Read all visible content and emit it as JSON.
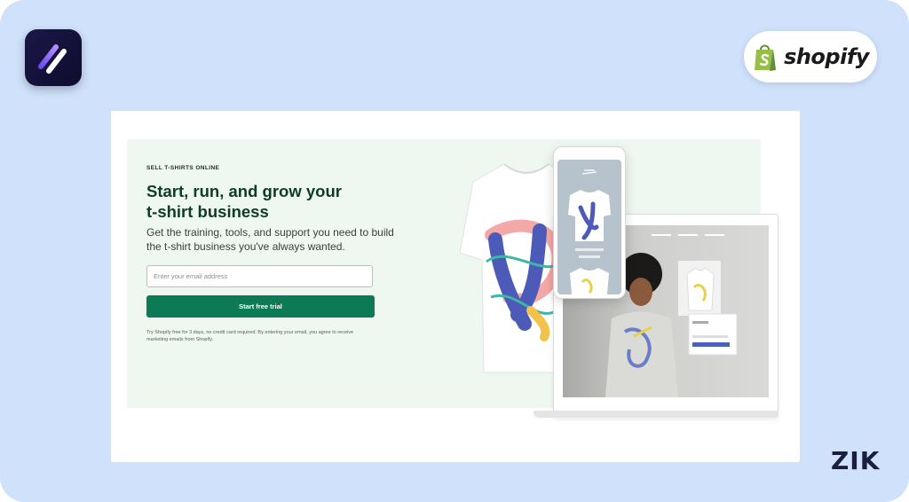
{
  "branding": {
    "app_logo_icon": "stripes-logo-icon",
    "shopify_wordmark": "shopify",
    "corner_mark": "ZIK"
  },
  "hero": {
    "eyebrow": "SELL T-SHIRTS ONLINE",
    "headline": "Start, run, and grow your t-shirt business",
    "subhead": "Get the training, tools, and support you need to build the t-shirt business you've always wanted.",
    "email_placeholder": "Enter your email address",
    "cta_label": "Start free trial",
    "fine_print": "Try Shopify free for 3 days, no credit card required. By entering your email, you agree to receive marketing emails from Shopify."
  },
  "colors": {
    "background": "#cfe1fb",
    "hero_bg": "#eef7f0",
    "cta": "#0b7a55",
    "headline": "#0e3b2c"
  }
}
